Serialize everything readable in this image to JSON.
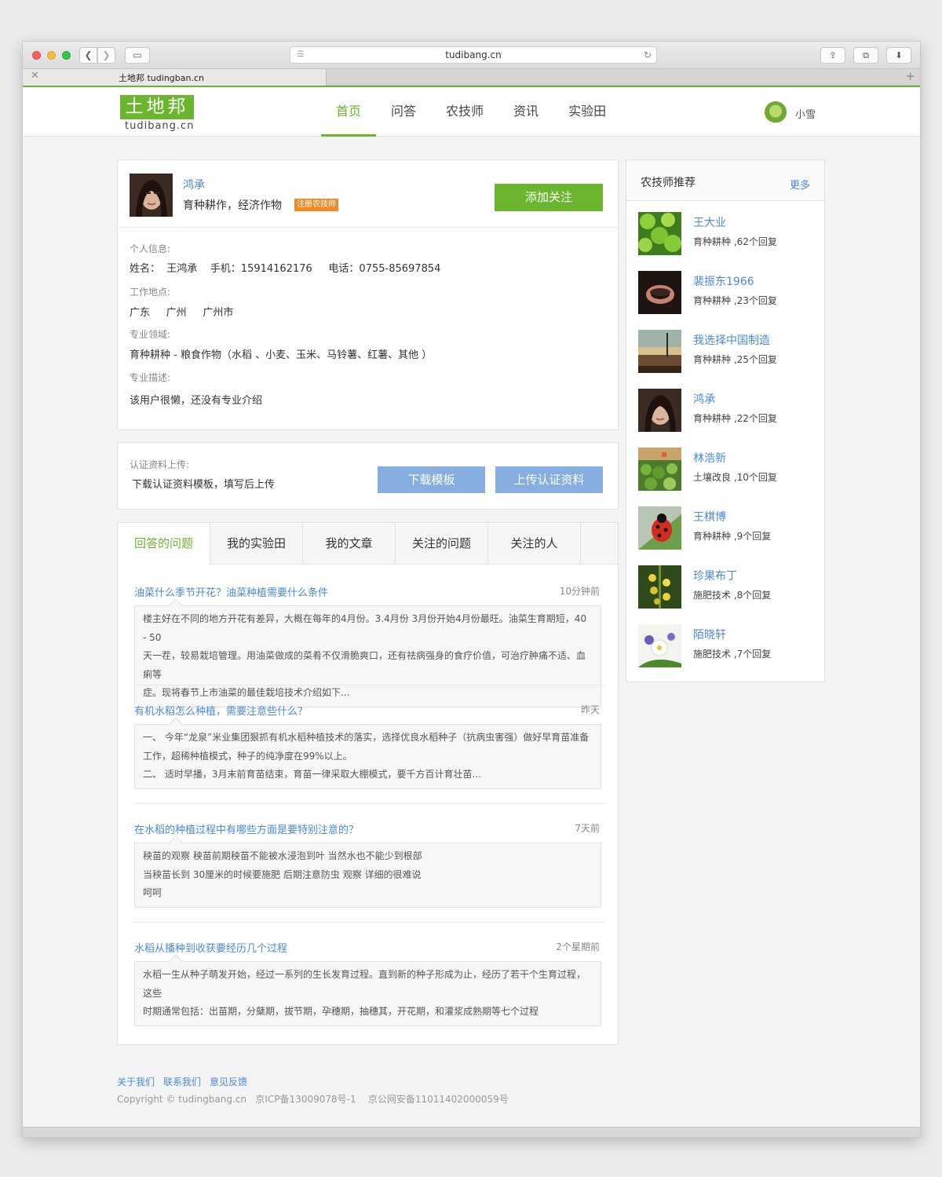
{
  "browser": {
    "url": "tudibang.cn",
    "tab_title": "土地邦 tudingban.cn"
  },
  "site": {
    "logo_text": "土地邦",
    "logo_sub": "tudibang.cn",
    "brand_color": "#6cb52f",
    "link_color": "#4a8ad3",
    "nav": [
      "首页",
      "问答",
      "农技师",
      "资讯",
      "实验田"
    ],
    "active_nav": "首页",
    "user_name": "小雪"
  },
  "profile": {
    "name": "鸿承",
    "field": "育种耕作，经济作物",
    "badge": "注册农技师",
    "follow_label": "添加关注",
    "personal_label": "个人信息:",
    "personal_value": "姓名：  王鸿承    手机：15914162176     电话：0755-85697854",
    "location_label": "工作地点:",
    "location_value": "广东     广州     广州市",
    "specialty_label": "专业领域:",
    "specialty_value": "育种耕种 - 粮食作物（水稻 、小麦、玉米、马铃薯、红薯、其他 ）",
    "description_label": "专业描述:",
    "description_value": "该用户很懒，还没有专业介绍"
  },
  "upload": {
    "label": "认证资料上传:",
    "desc": "下载认证资料模板，填写后上传",
    "download_label": "下载模板",
    "upload_label": "上传认证资料"
  },
  "tabs": [
    "回答的问题",
    "我的实验田",
    "我的文章",
    "关注的问题",
    "关注的人"
  ],
  "questions": [
    {
      "title": "油菜什么季节开花？油菜种植需要什么条件",
      "time": "10分钟前",
      "answer": [
        "楼主好在不同的地方开花有差异，大概在每年的4月份。3.4月份 3月份开始4月份最旺。油菜生育期短，40 - 50",
        "天一茬，较易栽培管理。用油菜做成的菜肴不仅滑脆爽口，还有祛病强身的食疗价值，可治疗肿痛不适、血痢等",
        "症。现将春节上市油菜的最佳栽培技术介绍如下..."
      ]
    },
    {
      "title": "有机水稻怎么种植，需要注意些什么？",
      "time": "昨天",
      "answer": [
        "一、 今年“龙泉”米业集团狠抓有机水稻种植技术的落实，选择优良水稻种子（抗病虫害强）做好早育苗准备",
        "工作，超稀种植模式，种子的纯净度在99%以上。",
        "二、 适时早播，3月末前育苗结束，育苗一律采取大棚模式，要千方百计育壮苗..."
      ]
    },
    {
      "title": "在水稻的种植过程中有哪些方面是要特别注意的？",
      "time": "7天前",
      "answer": [
        "秧苗的观察 秧苗前期秧苗不能被水浸泡到叶  当然水也不能少到根部",
        "当秧苗长到 30厘米的时候要施肥  后期注意防虫 观察 详细的很难说",
        "呵呵"
      ]
    },
    {
      "title": "水稻从播种到收获要经历几个过程",
      "time": "2个星期前",
      "answer": [
        "水稻一生从种子萌发开始，经过一系列的生长发育过程。直到新的种子形成为止，经历了若干个生育过程，这些",
        "时期通常包括：出苗期，分蘖期，拔节期，孕穗期，抽穗其，开花期，和灌浆成熟期等七个过程"
      ]
    }
  ],
  "sidebar": {
    "title": "农技师推荐",
    "more": "更多",
    "experts": [
      {
        "name": "王大业",
        "meta": "育种耕种 ,62个回复",
        "icon": "clover-photo"
      },
      {
        "name": "裴振东1966",
        "meta": "育种耕种 ,23个回复",
        "icon": "ring-photo"
      },
      {
        "name": "我选择中国制造",
        "meta": "育种耕种 ,25个回复",
        "icon": "street-photo"
      },
      {
        "name": "鸿承",
        "meta": "育种耕种 ,22个回复",
        "icon": "portrait-photo"
      },
      {
        "name": "林浩新",
        "meta": "土壤改良 ,10个回复",
        "icon": "market-photo"
      },
      {
        "name": "王棋博",
        "meta": "育种耕种 ,9个回复",
        "icon": "ladybug-photo"
      },
      {
        "name": "珍果布丁",
        "meta": "施肥技术 ,8个回复",
        "icon": "yellow-flower-photo"
      },
      {
        "name": "陌晓轩",
        "meta": "施肥技术 ,7个回复",
        "icon": "white-flower-photo"
      }
    ]
  },
  "footer": {
    "links": [
      "关于我们",
      "联系我们",
      "意见反馈"
    ],
    "copyright": "Copyright © tudingbang.cn   京ICP备13009078号-1    京公网安备11011402000059号"
  }
}
